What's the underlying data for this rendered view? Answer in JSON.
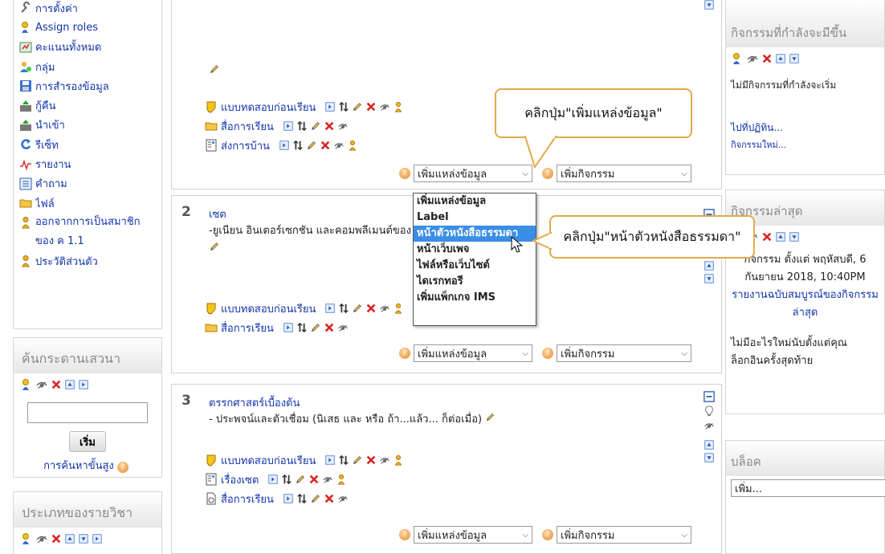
{
  "admin_menu": [
    {
      "label": "การตั้งค่า",
      "icon": "wrench-icon"
    },
    {
      "label": "Assign roles",
      "icon": "users-icon"
    },
    {
      "label": "คะแนนทั้งหมด",
      "icon": "grades-icon"
    },
    {
      "label": "กลุ่ม",
      "icon": "groups-icon"
    },
    {
      "label": "การสำรองข้อมูล",
      "icon": "backup-icon"
    },
    {
      "label": "กู้คืน",
      "icon": "restore-icon"
    },
    {
      "label": "นำเข้า",
      "icon": "import-icon"
    },
    {
      "label": "รีเซ็ท",
      "icon": "reset-icon"
    },
    {
      "label": "รายงาน",
      "icon": "report-icon"
    },
    {
      "label": "คำถาม",
      "icon": "questions-icon"
    },
    {
      "label": "ไฟล์",
      "icon": "folder-icon"
    },
    {
      "label": "ออกจากการเป็นสมาชิกของ ค 1.1",
      "icon": "user-icon"
    },
    {
      "label": "ประวัติส่วนตัว",
      "icon": "user-icon"
    }
  ],
  "search_block": {
    "title": "ค้นกระดานเสวนา",
    "button": "เริ่ม",
    "advanced": "การค้นหาขั้นสูง"
  },
  "category_block": {
    "title": "ประเภทของรายวิชา"
  },
  "section1": {
    "activities": [
      {
        "label": "แบบทดสอบก่อนเรียน",
        "icon": "quiz-icon"
      },
      {
        "label": "สื่อการเรียน",
        "icon": "folder-icon"
      },
      {
        "label": "ส่งการบ้าน",
        "icon": "assignment-icon"
      }
    ]
  },
  "section2": {
    "num": "2",
    "title": "เซต",
    "summary": "-ยูเนียน อินเตอร์เซกชัน และคอมพลีเมนต์ของ",
    "activities": [
      {
        "label": "แบบทดสอบก่อนเรียน",
        "icon": "quiz-icon"
      },
      {
        "label": "สื่อการเรียน",
        "icon": "folder-icon"
      }
    ]
  },
  "section3": {
    "num": "3",
    "title": "ตรรกศาสตร์เบื้องต้น",
    "summary": "- ประพจน์และตัวเชื่อม (นิเสธ และ หรือ ถ้า...แล้ว... ก็ต่อเมื่อ)",
    "activities": [
      {
        "label": "แบบทดสอบก่อนเรียน",
        "icon": "quiz-icon"
      },
      {
        "label": "เรื่องเซต",
        "icon": "assignment-icon"
      },
      {
        "label": "สื่อการเรียน",
        "icon": "file-icon"
      }
    ]
  },
  "selects": {
    "resource": "เพิ่มแหล่งข้อมูล",
    "activity": "เพิ่มกิจกรรม"
  },
  "dropdown_options": [
    "เพิ่มแหล่งข้อมูล",
    "Label",
    "หน้าตัวหนังสือธรรมดา",
    "หน้าเว็บเพจ",
    "ไฟล์หรือเว็บไซต์",
    "ไดเรกทอรี",
    "เพิ่มแพ็กเกจ IMS"
  ],
  "dropdown_selected_index": 2,
  "callouts": {
    "add_resource": "คลิกปุ่ม\"เพิ่มแหล่งข้อมูล\"",
    "plain_text": "คลิกปุ่ม\"หน้าตัวหนังสือธรรมดา\""
  },
  "upcoming": {
    "title": "กิจกรรมที่กำลังจะมีขึ้น",
    "empty": "ไม่มีกิจกรรมที่กำลังจะเริ่ม",
    "calendar_link": "ไปที่ปฏิทิน...",
    "new_event_link": "กิจกรรมใหม่..."
  },
  "recent": {
    "title": "กิจกรรมล่าสุด",
    "since": "กิจกรรม ตั้งแต่ พฤหัสบดี, 6 กันยายน 2018, 10:40PM",
    "full_report": "รายงานฉบับสมบูรณ์ของกิจกรรมล่าสุด",
    "nothing_new": "ไม่มีอะไรใหม่นับตั้งแต่คุณล็อกอินครั้งสุดท้าย"
  },
  "blocks": {
    "title": "บล็อค",
    "add": "เพิ่ม..."
  }
}
